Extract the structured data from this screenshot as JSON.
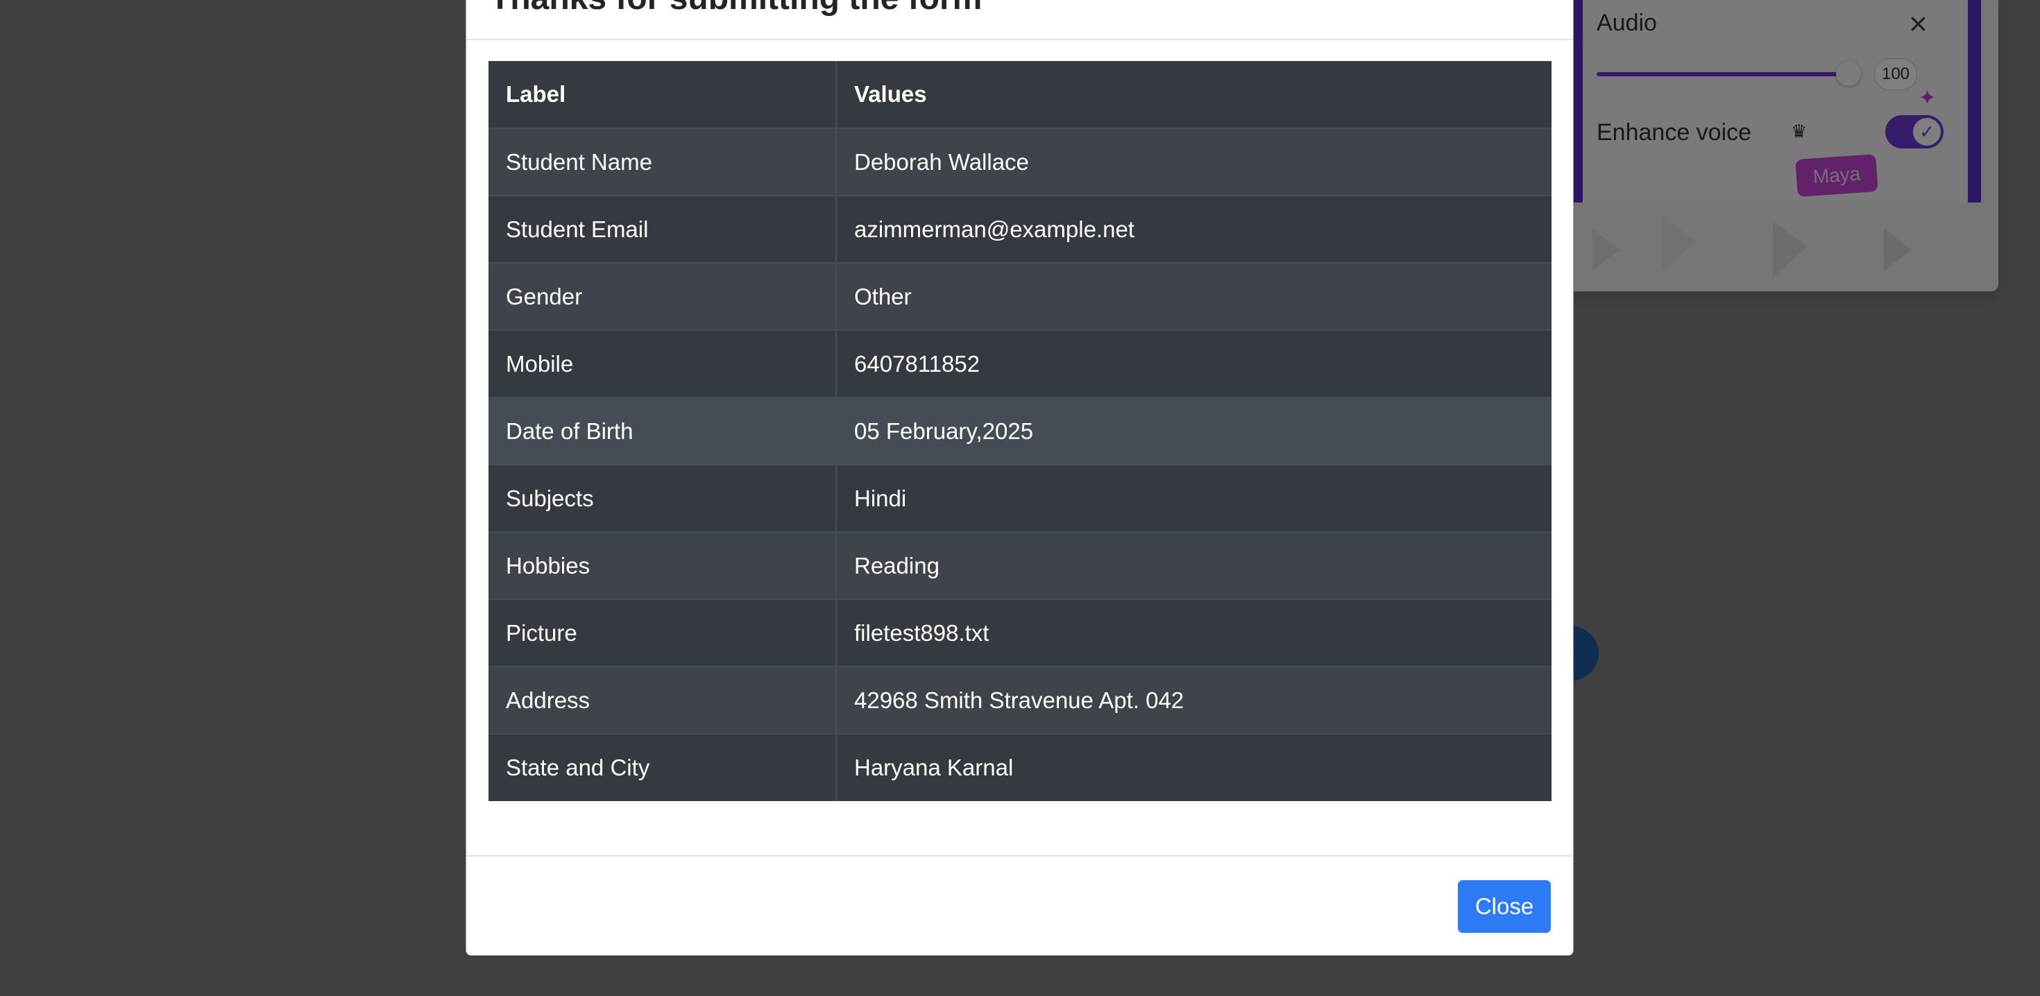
{
  "background": {
    "audio_panel": {
      "title": "Audio",
      "volume_value": "100",
      "enhance_label": "Enhance voice",
      "badge": "Maya"
    }
  },
  "modal": {
    "title": "Thanks for submitting the form",
    "table": {
      "headers": [
        "Label",
        "Values"
      ],
      "rows": [
        {
          "label": "Student Name",
          "value": "Deborah Wallace"
        },
        {
          "label": "Student Email",
          "value": "azimmerman@example.net"
        },
        {
          "label": "Gender",
          "value": "Other"
        },
        {
          "label": "Mobile",
          "value": "6407811852"
        },
        {
          "label": "Date of Birth",
          "value": "05 February,2025"
        },
        {
          "label": "Subjects",
          "value": "Hindi"
        },
        {
          "label": "Hobbies",
          "value": "Reading"
        },
        {
          "label": "Picture",
          "value": "filetest898.txt"
        },
        {
          "label": "Address",
          "value": "42968 Smith Stravenue Apt. 042"
        },
        {
          "label": "State and City",
          "value": "Haryana Karnal"
        }
      ]
    },
    "close_label": "Close"
  },
  "colors": {
    "table_dark": "#343a40",
    "close_button": "#2e7bf6",
    "accent_purple": "#6b3ad6"
  }
}
